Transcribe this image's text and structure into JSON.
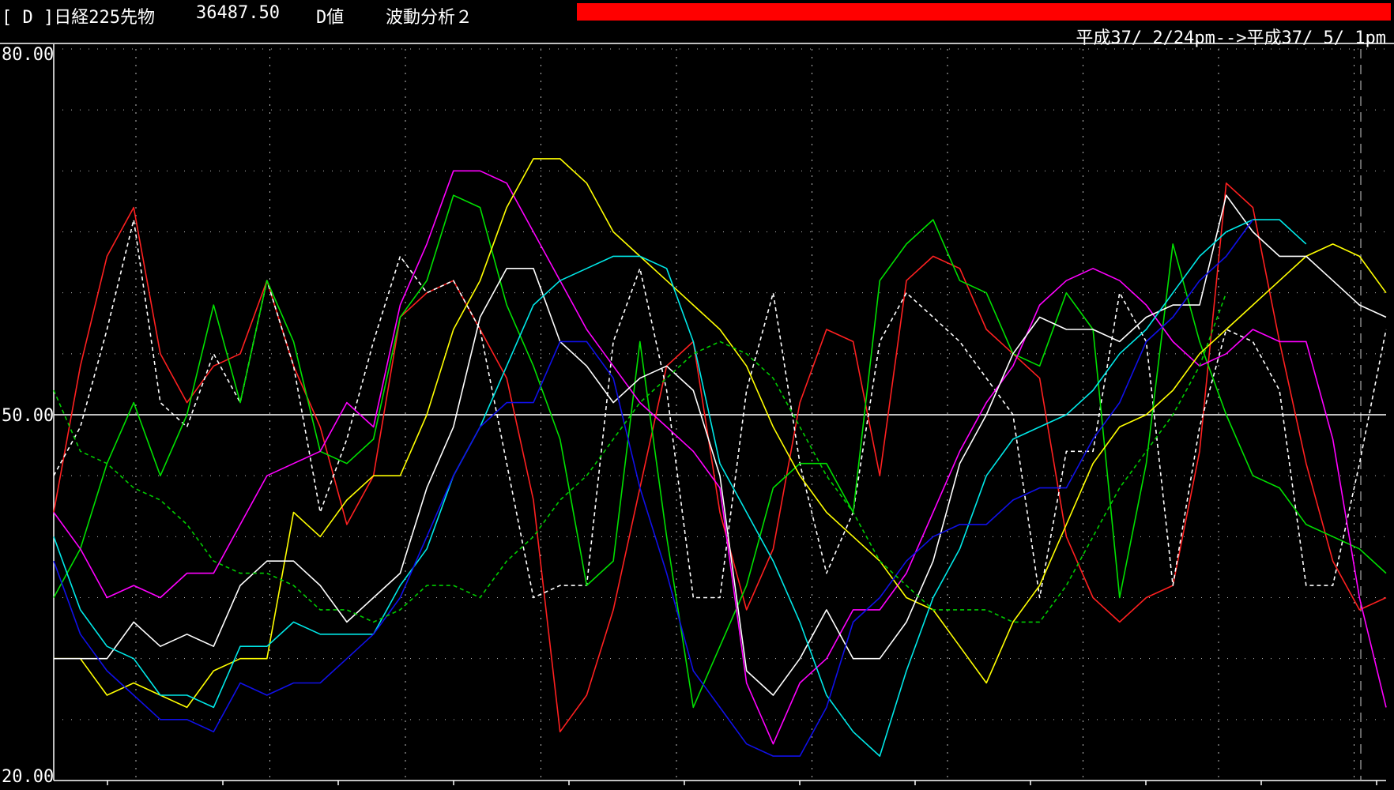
{
  "header": {
    "instrument": "[ D ]日経225先物",
    "price": "36487.50",
    "value_label": "D値",
    "analysis": "波動分析２",
    "bar_color": "#ff0000"
  },
  "range_text": "平成37/ 2/24pm-->平成37/ 5/ 1pm",
  "chart_data": {
    "type": "line",
    "ylim": [
      20,
      80
    ],
    "y_ticks": [
      "80.00",
      "50.00",
      "20.00"
    ],
    "n_points": 51,
    "reference_line": 50,
    "series": [
      {
        "color": "#ff2020",
        "dash": false,
        "values": [
          42,
          54,
          63,
          67,
          55,
          51,
          54,
          55,
          61,
          54,
          49,
          41,
          45,
          58,
          60,
          61,
          57,
          53,
          43,
          24,
          27,
          34,
          44,
          54,
          56,
          42,
          34,
          39,
          51,
          57,
          56,
          45,
          61,
          63,
          62,
          57,
          55,
          53,
          40,
          35,
          33,
          35,
          36,
          47,
          69,
          67,
          56,
          46,
          38,
          34,
          35
        ]
      },
      {
        "color": "#ffffff",
        "dash": true,
        "values": [
          45,
          49,
          57,
          66,
          51,
          49,
          55,
          51,
          61,
          54,
          42,
          48,
          56,
          63,
          60,
          61,
          57,
          46,
          35,
          36,
          36,
          56,
          62,
          52,
          35,
          35,
          52,
          60,
          46,
          37,
          42,
          56,
          60,
          58,
          56,
          53,
          50,
          35,
          47,
          47,
          60,
          56,
          36,
          49,
          57,
          56,
          52,
          36,
          36,
          46,
          57
        ]
      },
      {
        "color": "#00e000",
        "dash": false,
        "values": [
          35,
          39,
          46,
          51,
          45,
          50,
          59,
          51,
          61,
          56,
          47,
          46,
          48,
          58,
          61,
          68,
          67,
          59,
          54,
          48,
          36,
          38,
          56,
          40,
          26,
          31,
          36,
          44,
          46,
          46,
          42,
          61,
          64,
          66,
          61,
          60,
          55,
          54,
          60,
          57,
          35,
          46,
          64,
          56,
          50,
          45,
          44,
          41,
          40,
          39,
          37
        ]
      },
      {
        "color": "#ff00ff",
        "dash": false,
        "values": [
          42,
          39,
          35,
          36,
          35,
          37,
          37,
          41,
          45,
          46,
          47,
          51,
          49,
          59,
          64,
          70,
          70,
          69,
          65,
          61,
          57,
          54,
          51,
          49,
          47,
          44,
          28,
          23,
          28,
          30,
          34,
          34,
          37,
          42,
          47,
          51,
          54,
          59,
          61,
          62,
          61,
          59,
          56,
          54,
          55,
          57,
          56,
          56,
          48,
          35,
          26
        ]
      },
      {
        "color": "#ffff00",
        "dash": false,
        "values": [
          30,
          30,
          27,
          28,
          27,
          26,
          29,
          30,
          30,
          42,
          40,
          43,
          45,
          45,
          50,
          57,
          61,
          67,
          71,
          71,
          69,
          65,
          63,
          61,
          59,
          57,
          54,
          49,
          45,
          42,
          40,
          38,
          35,
          34,
          31,
          28,
          33,
          36,
          41,
          46,
          49,
          50,
          52,
          55,
          57,
          59,
          61,
          63,
          64,
          63,
          60
        ]
      },
      {
        "color": "#ffffff",
        "dash": false,
        "values": [
          30,
          30,
          30,
          33,
          31,
          32,
          31,
          36,
          38,
          38,
          36,
          33,
          35,
          37,
          44,
          49,
          58,
          62,
          62,
          56,
          54,
          51,
          53,
          54,
          52,
          45,
          29,
          27,
          30,
          34,
          30,
          30,
          33,
          38,
          46,
          50,
          55,
          58,
          57,
          57,
          56,
          58,
          59,
          59,
          68,
          65,
          63,
          63,
          61,
          59,
          58
        ]
      },
      {
        "color": "#00e8e8",
        "dash": false,
        "values": [
          40,
          34,
          31,
          30,
          27,
          27,
          26,
          31,
          31,
          33,
          32,
          32,
          32,
          36,
          39,
          45,
          49,
          54,
          59,
          61,
          62,
          63,
          63,
          62,
          56,
          46,
          42,
          38,
          33,
          27,
          24,
          22,
          29,
          35,
          39,
          45,
          48,
          49,
          50,
          52,
          55,
          57,
          60,
          63,
          65,
          66,
          66,
          64
        ]
      },
      {
        "color": "#1010e8",
        "dash": false,
        "values": [
          38,
          32,
          29,
          27,
          25,
          25,
          24,
          28,
          27,
          28,
          28,
          30,
          32,
          35,
          40,
          45,
          49,
          51,
          51,
          56,
          56,
          53,
          44,
          37,
          29,
          26,
          23,
          22,
          22,
          26,
          33,
          35,
          38,
          40,
          41,
          41,
          43,
          44,
          44,
          48,
          51,
          56,
          58,
          61,
          63,
          66
        ]
      },
      {
        "color": "#00cc00",
        "dash": true,
        "values": [
          52,
          47,
          46,
          44,
          43,
          41,
          38,
          37,
          37,
          36,
          34,
          34,
          33,
          34,
          36,
          36,
          35,
          38,
          40,
          43,
          45,
          48,
          51,
          53,
          55,
          56,
          55,
          53,
          49,
          45,
          42,
          38,
          36,
          34,
          34,
          34,
          33,
          33,
          36,
          40,
          44,
          47,
          50,
          54,
          60
        ]
      }
    ]
  }
}
